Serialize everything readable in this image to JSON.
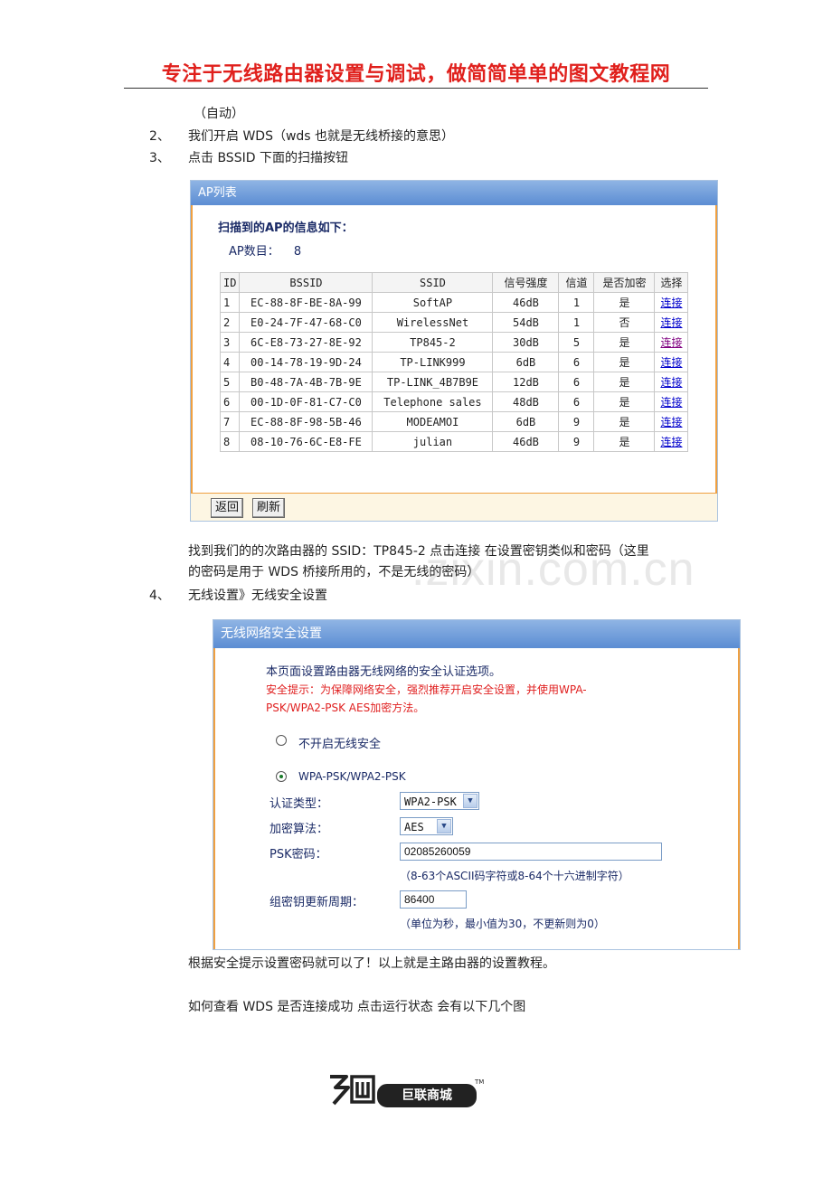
{
  "header": {
    "title": "专注于无线路由器设置与调试，做简简单单的图文教程网"
  },
  "intro": {
    "auto": "（自动）"
  },
  "steps": [
    {
      "num": "2、",
      "text": "我们开启 WDS（wds 也就是无线桥接的意思）"
    },
    {
      "num": "3、",
      "text": "点击 BSSID 下面的扫描按钮"
    },
    {
      "num": "4、",
      "text": "无线设置》无线安全设置"
    }
  ],
  "ap_list": {
    "title": "AP列表",
    "scan_info": "扫描到的AP的信息如下：",
    "count_label": "AP数目：",
    "count_value": "8",
    "columns": [
      "ID",
      "BSSID",
      "SSID",
      "信号强度",
      "信道",
      "是否加密",
      "选择"
    ],
    "rows": [
      {
        "id": "1",
        "bssid": "EC-88-8F-BE-8A-99",
        "ssid": "SoftAP",
        "signal": "46dB",
        "channel": "1",
        "encrypted": "是",
        "select": "连接",
        "visited": false
      },
      {
        "id": "2",
        "bssid": "E0-24-7F-47-68-C0",
        "ssid": "WirelessNet",
        "signal": "54dB",
        "channel": "1",
        "encrypted": "否",
        "select": "连接",
        "visited": false
      },
      {
        "id": "3",
        "bssid": "6C-E8-73-27-8E-92",
        "ssid": "TP845-2",
        "signal": "30dB",
        "channel": "5",
        "encrypted": "是",
        "select": "连接",
        "visited": true
      },
      {
        "id": "4",
        "bssid": "00-14-78-19-9D-24",
        "ssid": "TP-LINK999",
        "signal": "6dB",
        "channel": "6",
        "encrypted": "是",
        "select": "连接",
        "visited": false
      },
      {
        "id": "5",
        "bssid": "B0-48-7A-4B-7B-9E",
        "ssid": "TP-LINK_4B7B9E",
        "signal": "12dB",
        "channel": "6",
        "encrypted": "是",
        "select": "连接",
        "visited": false
      },
      {
        "id": "6",
        "bssid": "00-1D-0F-81-C7-C0",
        "ssid": "Telephone sales",
        "signal": "48dB",
        "channel": "6",
        "encrypted": "是",
        "select": "连接",
        "visited": false
      },
      {
        "id": "7",
        "bssid": "EC-88-8F-98-5B-46",
        "ssid": "MODEAMOI",
        "signal": "6dB",
        "channel": "9",
        "encrypted": "是",
        "select": "连接",
        "visited": false
      },
      {
        "id": "8",
        "bssid": "08-10-76-6C-E8-FE",
        "ssid": "julian",
        "signal": "46dB",
        "channel": "9",
        "encrypted": "是",
        "select": "连接",
        "visited": false
      }
    ],
    "back_button": "返回",
    "refresh_button": "刷新"
  },
  "after_ap": {
    "line1": "找到我们的的次路由器的 SSID：TP845-2  点击连接  在设置密钥类似和密码（这里",
    "line2": "的密码是用于 WDS 桥接所用的，不是无线的密码）"
  },
  "security": {
    "title": "无线网络安全设置",
    "desc": "本页面设置路由器无线网络的安全认证选项。",
    "tip1": "安全提示：为保障网络安全，强烈推荐开启安全设置，并使用WPA-",
    "tip2": "PSK/WPA2-PSK AES加密方法。",
    "option_off": "不开启无线安全",
    "option_wpa": "WPA-PSK/WPA2-PSK",
    "auth_label": "认证类型：",
    "auth_value": "WPA2-PSK",
    "enc_label": "加密算法：",
    "enc_value": "AES",
    "psk_label": "PSK密码：",
    "psk_value": "02085260059",
    "psk_hint": "（8-63个ASCII码字符或8-64个十六进制字符）",
    "period_label": "组密钥更新周期：",
    "period_value": "86400",
    "period_hint": "（单位为秒，最小值为30，不更新则为0）",
    "selected": "wpa"
  },
  "footer_text": {
    "line1": "根据安全提示设置密码就可以了！以上就是主路由器的设置教程。",
    "line2": "如何查看 WDS 是否连接成功  点击运行状态    会有以下几个图"
  },
  "logo": {
    "brand": "巨联商城",
    "tm": "TM"
  },
  "watermark": {
    "text": ".zixin.com.cn"
  },
  "colors": {
    "header_red": "#e0201c",
    "panel_blue": "#5b8dd3",
    "panel_border_orange": "#f0a040",
    "tip_red": "#e02020"
  }
}
